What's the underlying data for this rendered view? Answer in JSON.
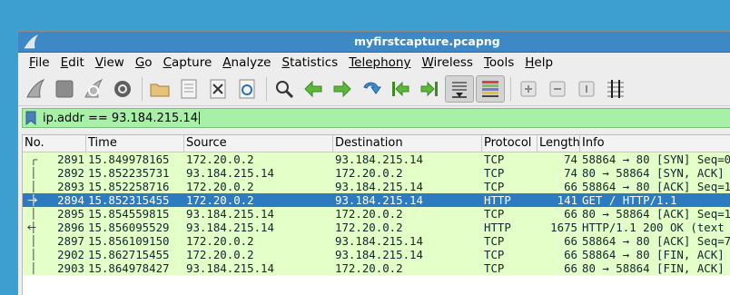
{
  "window": {
    "title": "myfirstcapture.pcapng"
  },
  "menu": [
    {
      "label": "File",
      "u": "F",
      "rest": "ile"
    },
    {
      "label": "Edit",
      "u": "E",
      "rest": "dit"
    },
    {
      "label": "View",
      "u": "V",
      "rest": "iew"
    },
    {
      "label": "Go",
      "u": "G",
      "rest": "o"
    },
    {
      "label": "Capture",
      "u": "C",
      "rest": "apture"
    },
    {
      "label": "Analyze",
      "u": "A",
      "rest": "nalyze"
    },
    {
      "label": "Statistics",
      "u": "S",
      "rest": "tatistics"
    },
    {
      "label": "Telephony",
      "u": "",
      "rest": "Telephony"
    },
    {
      "label": "Wireless",
      "u": "W",
      "rest": "ireless"
    },
    {
      "label": "Tools",
      "u": "T",
      "rest": "ools"
    },
    {
      "label": "Help",
      "u": "H",
      "rest": "elp"
    }
  ],
  "filter": {
    "value": "ip.addr == 93.184.215.14"
  },
  "columns": {
    "no": "No.",
    "time": "Time",
    "source": "Source",
    "destination": "Destination",
    "protocol": "Protocol",
    "length": "Length",
    "info": "Info"
  },
  "packets": [
    {
      "no": "2891",
      "time": "15.849978165",
      "source": "172.20.0.2",
      "destination": "93.184.215.14",
      "protocol": "TCP",
      "length": "74",
      "info": "58864 → 80 [SYN] Seq=0"
    },
    {
      "no": "2892",
      "time": "15.852235731",
      "source": "93.184.215.14",
      "destination": "172.20.0.2",
      "protocol": "TCP",
      "length": "74",
      "info": "80 → 58864 [SYN, ACK]"
    },
    {
      "no": "2893",
      "time": "15.852258716",
      "source": "172.20.0.2",
      "destination": "93.184.215.14",
      "protocol": "TCP",
      "length": "66",
      "info": "58864 → 80 [ACK] Seq=1"
    },
    {
      "no": "2894",
      "time": "15.852315455",
      "source": "172.20.0.2",
      "destination": "93.184.215.14",
      "protocol": "HTTP",
      "length": "141",
      "info": "GET / HTTP/1.1",
      "selected": true
    },
    {
      "no": "2895",
      "time": "15.854559815",
      "source": "93.184.215.14",
      "destination": "172.20.0.2",
      "protocol": "TCP",
      "length": "66",
      "info": "80 → 58864 [ACK] Seq=1"
    },
    {
      "no": "2896",
      "time": "15.856095529",
      "source": "93.184.215.14",
      "destination": "172.20.0.2",
      "protocol": "HTTP",
      "length": "1675",
      "info": "HTTP/1.1 200 OK  (text"
    },
    {
      "no": "2897",
      "time": "15.856109150",
      "source": "172.20.0.2",
      "destination": "93.184.215.14",
      "protocol": "TCP",
      "length": "66",
      "info": "58864 → 80 [ACK] Seq=7"
    },
    {
      "no": "2902",
      "time": "15.862715455",
      "source": "172.20.0.2",
      "destination": "93.184.215.14",
      "protocol": "TCP",
      "length": "66",
      "info": "58864 → 80 [FIN, ACK]"
    },
    {
      "no": "2903",
      "time": "15.864978427",
      "source": "93.184.215.14",
      "destination": "172.20.0.2",
      "protocol": "TCP",
      "length": "66",
      "info": "80 → 58864 [FIN, ACK]"
    }
  ],
  "icons": {
    "toolbar": [
      "start-capture-icon",
      "stop-capture-icon",
      "restart-capture-icon",
      "capture-options-icon",
      "open-file-icon",
      "save-file-icon",
      "close-file-icon",
      "reload-file-icon",
      "find-packet-icon",
      "go-back-icon",
      "go-forward-icon",
      "go-to-packet-icon",
      "first-packet-icon",
      "last-packet-icon",
      "autoscroll-icon",
      "colorize-icon",
      "zoom-in-icon",
      "zoom-out-icon",
      "normal-size-icon",
      "resize-columns-icon"
    ]
  },
  "colors": {
    "titlebar": "#3f88c6",
    "filter_valid": "#a8f0a8",
    "row_tcp_http": "#e4ffc7",
    "row_selected": "#2c7bc1"
  }
}
